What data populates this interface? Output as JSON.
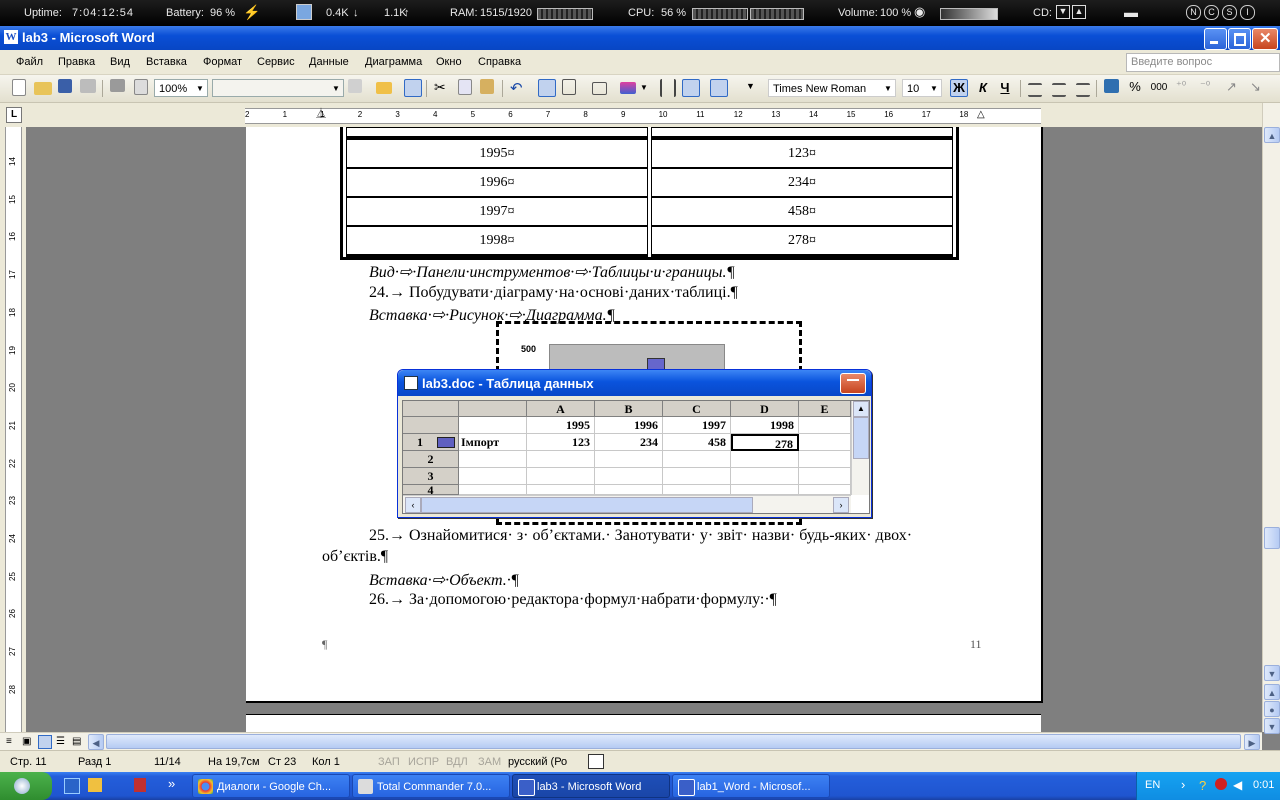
{
  "sysbar": {
    "uptime_label": "Uptime:",
    "uptime_value": "7:04:12:54",
    "battery_label": "Battery:",
    "battery_value": "96 %",
    "net_down": "0.4K",
    "net_up": "1.1K",
    "ram_label": "RAM:",
    "ram_value": "1515/1920",
    "cpu_label": "CPU:",
    "cpu_value": "56 %",
    "volume_label": "Volume:",
    "volume_value": "100 %",
    "cd_label": "CD:",
    "lock_n": "N",
    "lock_c": "C",
    "lock_s": "S",
    "lock_i": "I"
  },
  "window": {
    "title": "lab3 - Microsoft Word"
  },
  "menu": {
    "items": [
      "Файл",
      "Правка",
      "Вид",
      "Вставка",
      "Формат",
      "Сервис",
      "Данные",
      "Диаграмма",
      "Окно",
      "Справка"
    ],
    "help_placeholder": "Введите вопрос"
  },
  "toolbar": {
    "zoom": "100%",
    "font": "Times New Roman",
    "size": "10",
    "bold": "Ж",
    "italic": "К",
    "underline": "Ч",
    "percent": "%",
    "thousands": "000"
  },
  "ruler": {
    "h_ticks": [
      "2",
      "1",
      "1",
      "2",
      "3",
      "4",
      "5",
      "6",
      "7",
      "8",
      "9",
      "10",
      "11",
      "12",
      "13",
      "14",
      "15",
      "16",
      "17",
      "18"
    ],
    "v_ticks": [
      "14",
      "15",
      "16",
      "17",
      "18",
      "19",
      "20",
      "21",
      "22",
      "23",
      "24",
      "25",
      "26",
      "27",
      "28"
    ]
  },
  "document": {
    "table_rows": [
      {
        "year": "1995¤",
        "value": "123¤"
      },
      {
        "year": "1996¤",
        "value": "234¤"
      },
      {
        "year": "1997¤",
        "value": "458¤"
      },
      {
        "year": "1998¤",
        "value": "278¤"
      }
    ],
    "p1": "Вид·⇨·Панели·инструментов·⇨·Таблицы·и·границы.¶",
    "p2": "24.→ Побудувати·діаграму·на·основі·даних·таблиці.¶",
    "p3": "Вставка·⇨·Рисунок·⇨·Диаграмма.¶",
    "chart_axis_label": "500",
    "p4": "25.→ Ознайомитися· з· об’єктами.· Занотувати· у· звіт· назви· будь-яких· двох·",
    "p4b": "об’єктів.¶",
    "p5": "Вставка·⇨·Объект.·¶",
    "p6": "26.→ За·допомогою·редактора·формул·набрати·формулу:·¶",
    "footer_pilcrow": "¶",
    "page_number": "11"
  },
  "datasheet": {
    "title": "lab3.doc - Таблица данных",
    "columns": [
      "A",
      "B",
      "C",
      "D",
      "E"
    ],
    "header_row": [
      "1995",
      "1996",
      "1997",
      "1998"
    ],
    "row1_label": "Імпорт",
    "row1_values": [
      "123",
      "234",
      "458",
      "278"
    ],
    "row_numbers": [
      "1",
      "2",
      "3",
      "4"
    ]
  },
  "status": {
    "page": "Стр.  11",
    "section": "Разд  1",
    "pages": "11/14",
    "at": "На  19,7см",
    "line": "Ст  23",
    "col": "Кол  1",
    "rec": "ЗАП",
    "trk": "ИСПР",
    "ext": "ВДЛ",
    "ovr": "ЗАМ",
    "lang": "русский (Ро"
  },
  "taskbar": {
    "tasks": [
      "Диалоги - Google Ch...",
      "Total Commander 7.0...",
      "lab3 - Microsoft Word",
      "lab1_Word - Microsof..."
    ],
    "lang": "EN",
    "clock": "0:01"
  }
}
